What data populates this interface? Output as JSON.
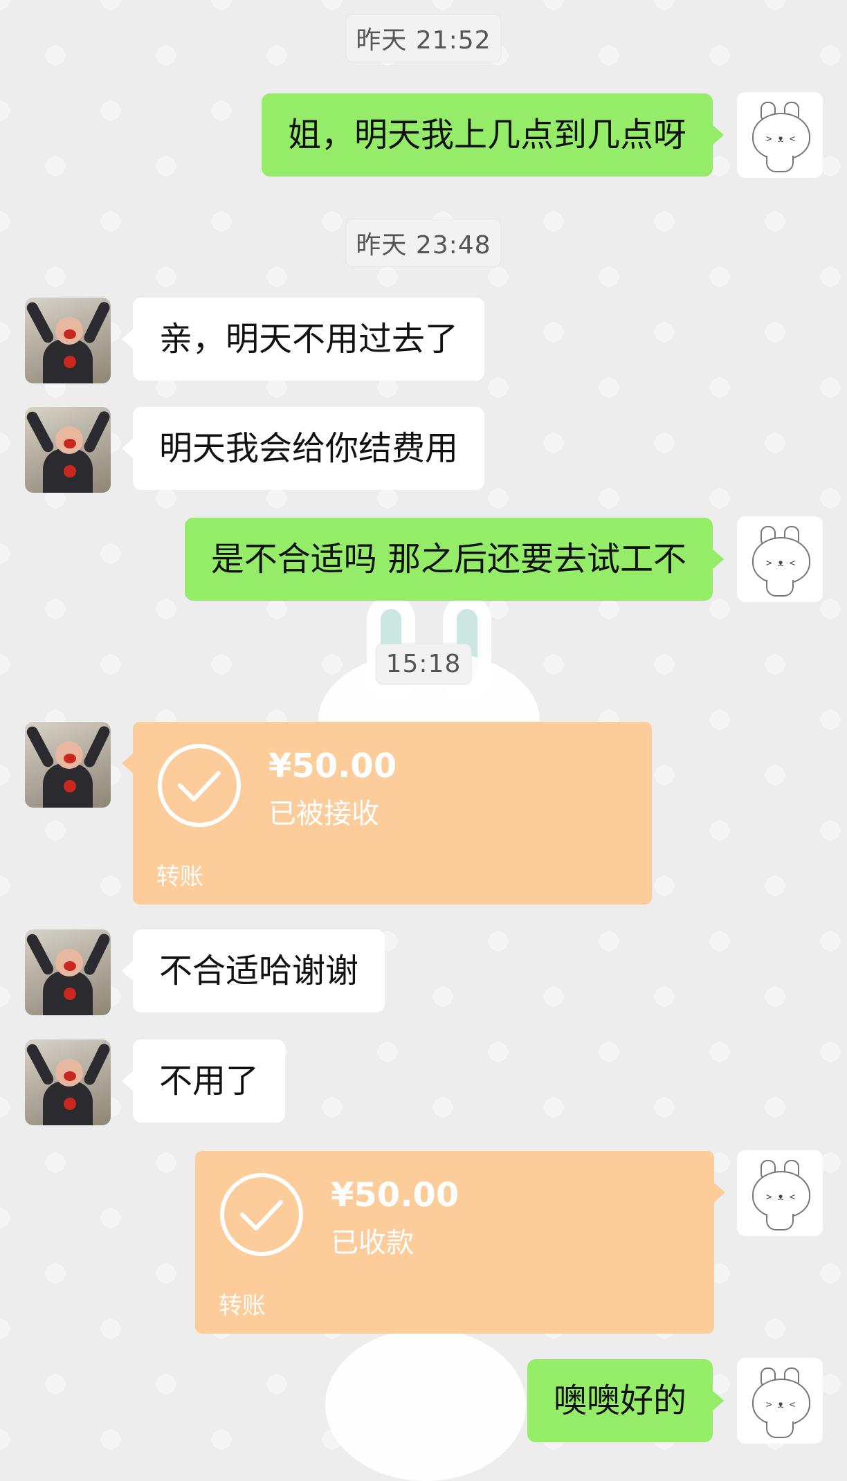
{
  "chat": {
    "timestamps": [
      "昨天 21:52",
      "昨天 23:48",
      "15:18"
    ],
    "messages": [
      {
        "from": "me",
        "type": "text",
        "text": "姐，明天我上几点到几点呀"
      },
      {
        "from": "her",
        "type": "text",
        "text": "亲，明天不用过去了"
      },
      {
        "from": "her",
        "type": "text",
        "text": "明天我会给你结费用"
      },
      {
        "from": "me",
        "type": "text",
        "text": "是不合适吗 那之后还要去试工不"
      },
      {
        "from": "her",
        "type": "transfer",
        "amount": "¥50.00",
        "status": "已被接收",
        "kind": "转账"
      },
      {
        "from": "her",
        "type": "text",
        "text": "不合适哈谢谢"
      },
      {
        "from": "her",
        "type": "text",
        "text": "不用了"
      },
      {
        "from": "me",
        "type": "transfer",
        "amount": "¥50.00",
        "status": "已收款",
        "kind": "转账"
      },
      {
        "from": "me",
        "type": "text",
        "text": "噢噢好的"
      }
    ]
  },
  "colors": {
    "background": "#ededed",
    "my_bubble": "#95ec69",
    "her_bubble": "#ffffff",
    "transfer_card": "#fccd9b"
  },
  "icons": {
    "my_avatar": "bunny-avatar-icon",
    "her_avatar": "cheering-person-avatar-icon",
    "transfer": "check-circle-icon"
  }
}
